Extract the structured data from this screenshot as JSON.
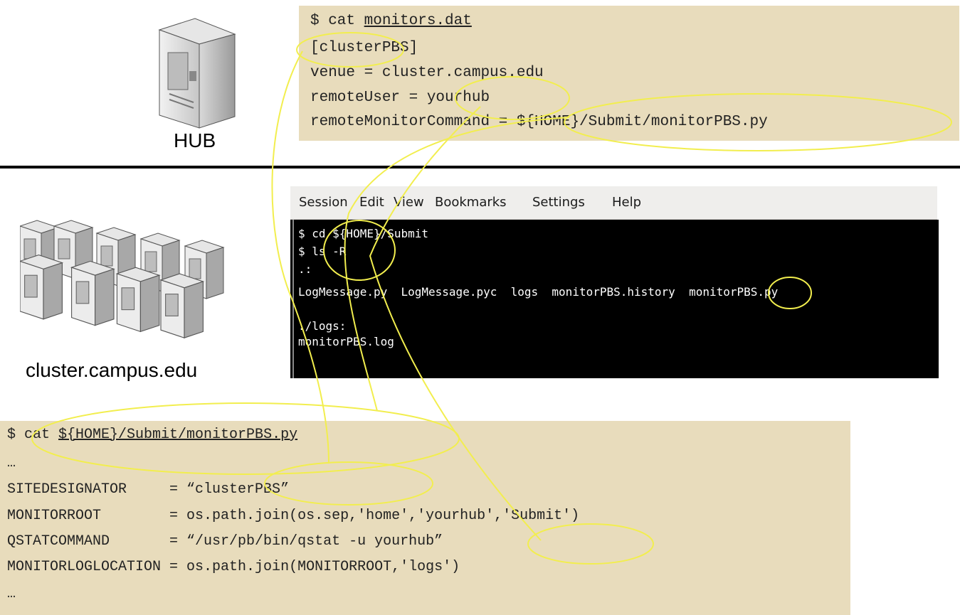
{
  "hub": {
    "label": "HUB"
  },
  "cluster": {
    "label": "cluster.campus.edu"
  },
  "top_file": {
    "prompt": "$ cat ",
    "filename": "monitors.dat",
    "lines": [
      "[clusterPBS]",
      "venue = cluster.campus.edu",
      "remoteUser = yourhub",
      "remoteMonitorCommand = ${HOME}/Submit/monitorPBS.py"
    ]
  },
  "terminal": {
    "menu": [
      "Session",
      "Edit",
      "View",
      "Bookmarks",
      "Settings",
      "Help"
    ],
    "lines": [
      "$ cd ${HOME}/Submit",
      "$ ls -R",
      ".:",
      "LogMessage.py  LogMessage.pyc  logs  monitorPBS.history  monitorPBS.py",
      "",
      "./logs:",
      "monitorPBS.log"
    ]
  },
  "bottom_file": {
    "prompt": "$ cat ",
    "filename": "${HOME}/Submit/monitorPBS.py",
    "lines": [
      "…",
      "SITEDESIGNATOR     = “clusterPBS”",
      "MONITORROOT        = os.path.join(os.sep,'home','yourhub','Submit')",
      "QSTATCOMMAND       = “/usr/pb/bin/qstat -u yourhub”",
      "MONITORLOGLOCATION = os.path.join(MONITORROOT,'logs')",
      "…"
    ]
  },
  "colors": {
    "box": "#e8dcbc",
    "annotation": "#f2ee4e",
    "terminal_bg": "#000000"
  }
}
